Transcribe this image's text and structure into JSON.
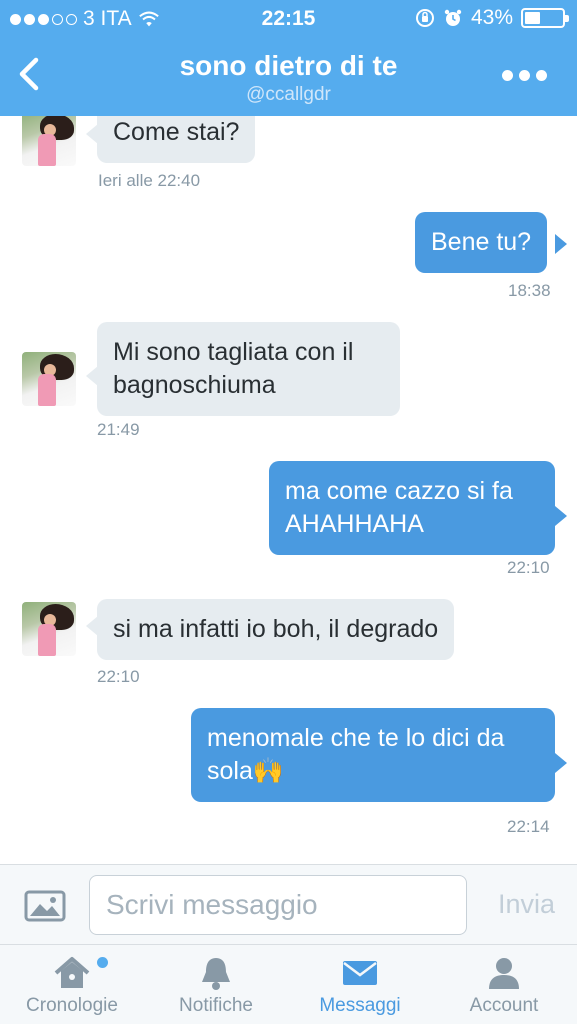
{
  "status_bar": {
    "carrier": "3 ITA",
    "signal_bars": 3,
    "time": "22:15",
    "battery_percent": "43%",
    "battery_level": 0.43
  },
  "header": {
    "title": "sono dietro di te",
    "handle": "@ccallgdr",
    "back_icon": "chevron-left-icon",
    "more_icon": "ellipsis-icon"
  },
  "messages": [
    {
      "direction": "in",
      "text": "Come stai?",
      "time": "Ieri alle 22:40"
    },
    {
      "direction": "out",
      "text": "Bene tu?",
      "time": "18:38"
    },
    {
      "direction": "in",
      "text": "Mi sono tagliata con il bagnoschiuma",
      "time": "21:49"
    },
    {
      "direction": "out",
      "text": "ma come cazzo si fa AHAHHAHA",
      "time": "22:10"
    },
    {
      "direction": "in",
      "text": "si ma infatti io boh, il degrado",
      "time": "22:10"
    },
    {
      "direction": "out",
      "text": "menomale che te lo dici da sola🙌",
      "time": "22:14"
    }
  ],
  "composer": {
    "placeholder": "Scrivi messaggio",
    "value": "",
    "send_label": "Invia",
    "photo_icon": "photo-icon"
  },
  "tabbar": {
    "tabs": [
      {
        "label": "Cronologie",
        "icon": "home-icon",
        "active": false,
        "has_dot": true
      },
      {
        "label": "Notifiche",
        "icon": "bell-icon",
        "active": false,
        "has_dot": false
      },
      {
        "label": "Messaggi",
        "icon": "envelope-icon",
        "active": true,
        "has_dot": false
      },
      {
        "label": "Account",
        "icon": "person-icon",
        "active": false,
        "has_dot": false
      }
    ]
  },
  "colors": {
    "brand": "#55acee",
    "outgoing_bubble": "#4a9ae0",
    "incoming_bubble": "#e6ecf0",
    "timestamp": "#8899a6"
  }
}
